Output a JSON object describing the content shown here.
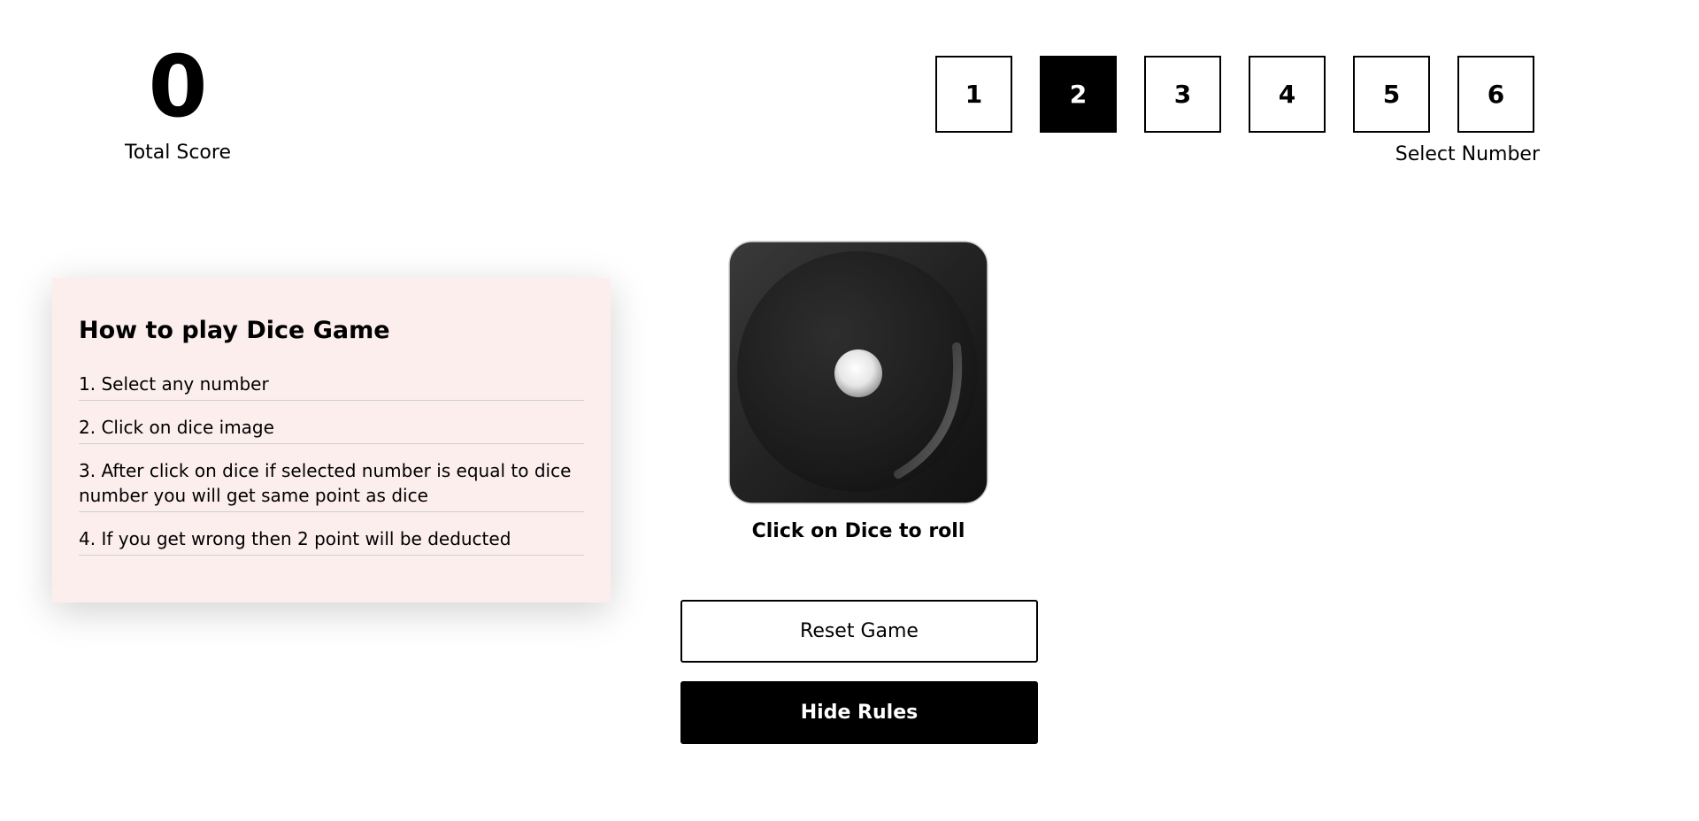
{
  "score": {
    "value": "0",
    "label": "Total Score"
  },
  "number_selector": {
    "numbers": [
      "1",
      "2",
      "3",
      "4",
      "5",
      "6"
    ],
    "selected": "2",
    "label": "Select Number"
  },
  "rules": {
    "title": "How to play Dice Game",
    "items": [
      "1. Select any number",
      "2. Click on dice image",
      "3. After click on dice if selected number is equal to dice number you will get same point as dice",
      "4. If you get wrong then 2 point will be deducted"
    ]
  },
  "dice": {
    "face": 1,
    "caption": "Click on Dice to roll"
  },
  "buttons": {
    "reset_label": "Reset Game",
    "hide_rules_label": "Hide Rules"
  },
  "colors": {
    "accent": "#000000",
    "rules_background": "#fdeeee",
    "dice_body": "#1f1f1f"
  }
}
